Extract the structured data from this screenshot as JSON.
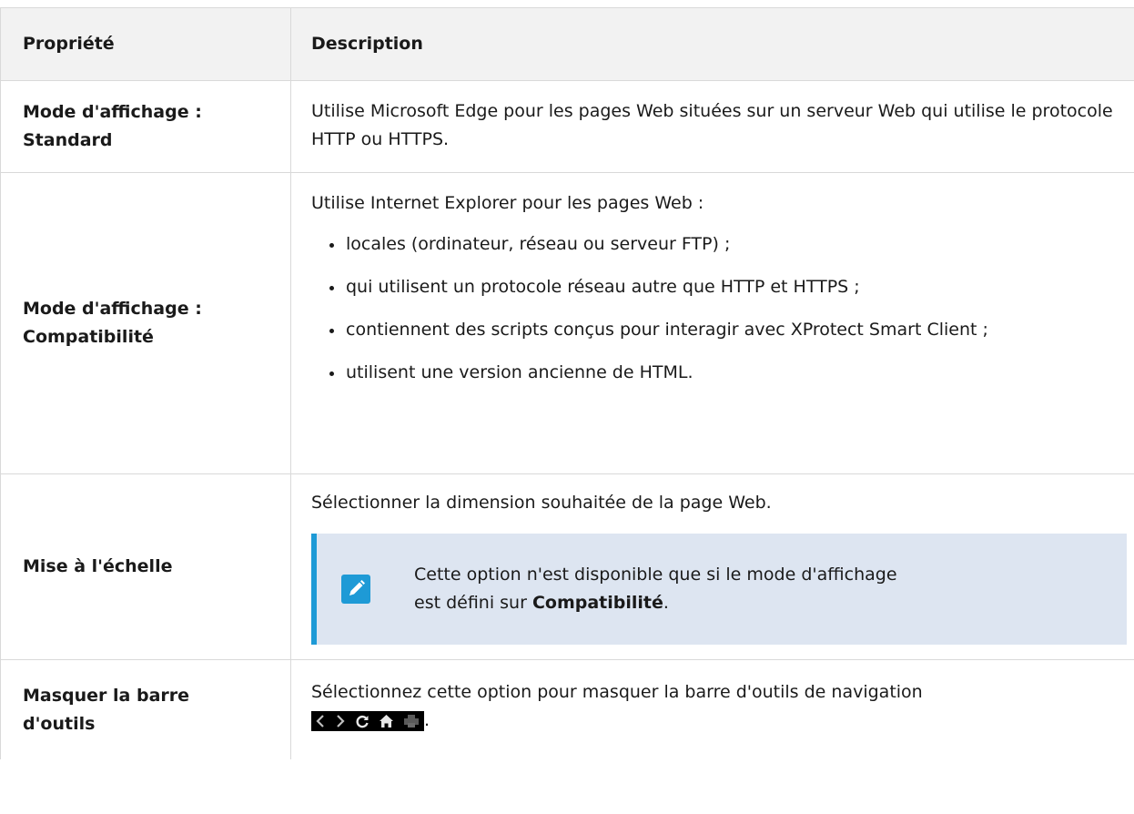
{
  "table": {
    "header": {
      "property": "Propriété",
      "description": "Description"
    },
    "rows": [
      {
        "property_line1": "Mode d'affichage :",
        "property_line2": "Standard",
        "description": "Utilise Microsoft Edge pour les pages Web situées sur un serveur Web qui utilise le protocole HTTP ou HTTPS."
      },
      {
        "property_line1": "Mode d'affichage :",
        "property_line2": "Compatibilité",
        "intro": "Utilise Internet Explorer pour les pages Web :",
        "bullets": [
          "locales (ordinateur, réseau ou serveur FTP) ;",
          "qui utilisent un protocole réseau autre que HTTP et HTTPS ;",
          "contiennent des scripts conçus pour interagir avec XProtect Smart Client ;",
          "utilisent une version ancienne de HTML."
        ]
      },
      {
        "property": "Mise à l'échelle",
        "description": "Sélectionner la dimension souhaitée de la page Web.",
        "note": {
          "icon": "pencil-icon",
          "line1": "Cette option n'est disponible que si le mode d'affichage",
          "line2_prefix": "est défini sur ",
          "line2_bold": "Compatibilité",
          "line2_suffix": "."
        }
      },
      {
        "property_line1": "Masquer la barre",
        "property_line2": "d'outils",
        "description": "Sélectionnez cette option pour masquer la barre d'outils de navigation",
        "description_suffix": ".",
        "toolbar_icons": [
          "back-icon",
          "forward-icon",
          "refresh-icon",
          "home-icon",
          "print-icon"
        ]
      }
    ]
  },
  "colors": {
    "header_bg": "#f2f2f2",
    "note_bg": "#dde5f1",
    "note_border": "#1e9ad6",
    "border": "#d9d9d9"
  }
}
